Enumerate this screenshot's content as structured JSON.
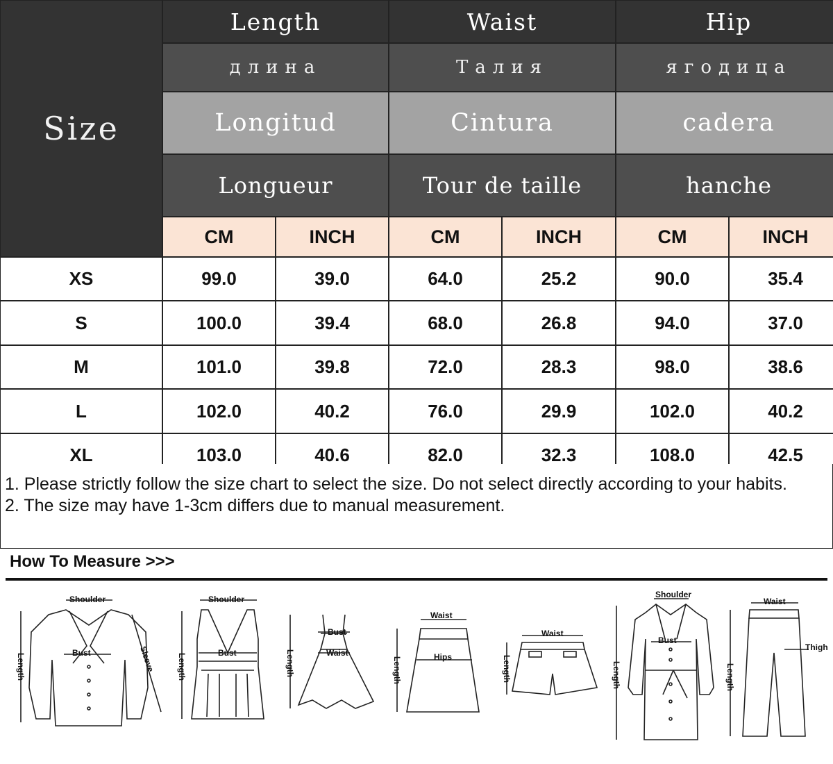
{
  "table": {
    "size_label": "Size",
    "headers": [
      {
        "en": "Length",
        "ru": "длина",
        "es": "Longitud",
        "fr": "Longueur"
      },
      {
        "en": "Waist",
        "ru": "Талия",
        "es": "Cintura",
        "fr": "Tour de taille"
      },
      {
        "en": "Hip",
        "ru": "ягодица",
        "es": "cadera",
        "fr": "hanche"
      }
    ],
    "units": [
      "CM",
      "INCH",
      "CM",
      "INCH",
      "CM",
      "INCH"
    ],
    "rows": [
      {
        "size": "XS",
        "values": [
          "99.0",
          "39.0",
          "64.0",
          "25.2",
          "90.0",
          "35.4"
        ]
      },
      {
        "size": "S",
        "values": [
          "100.0",
          "39.4",
          "68.0",
          "26.8",
          "94.0",
          "37.0"
        ]
      },
      {
        "size": "M",
        "values": [
          "101.0",
          "39.8",
          "72.0",
          "28.3",
          "98.0",
          "38.6"
        ]
      },
      {
        "size": "L",
        "values": [
          "102.0",
          "40.2",
          "76.0",
          "29.9",
          "102.0",
          "40.2"
        ]
      },
      {
        "size": "XL",
        "values": [
          "103.0",
          "40.6",
          "82.0",
          "32.3",
          "108.0",
          "42.5"
        ]
      }
    ]
  },
  "notes": [
    "1. Please strictly follow the size chart to select the size. Do not select directly according to your habits.",
    "2. The size may have 1-3cm differs due to manual measurement."
  ],
  "how_to_measure": {
    "title": "How To Measure >>>",
    "labels": {
      "shoulder": "Shoulder",
      "bust": "Bust",
      "sleeve": "Sleeve",
      "length": "Length",
      "waist": "Waist",
      "hips": "Hips",
      "thigh": "Thigh"
    }
  }
}
